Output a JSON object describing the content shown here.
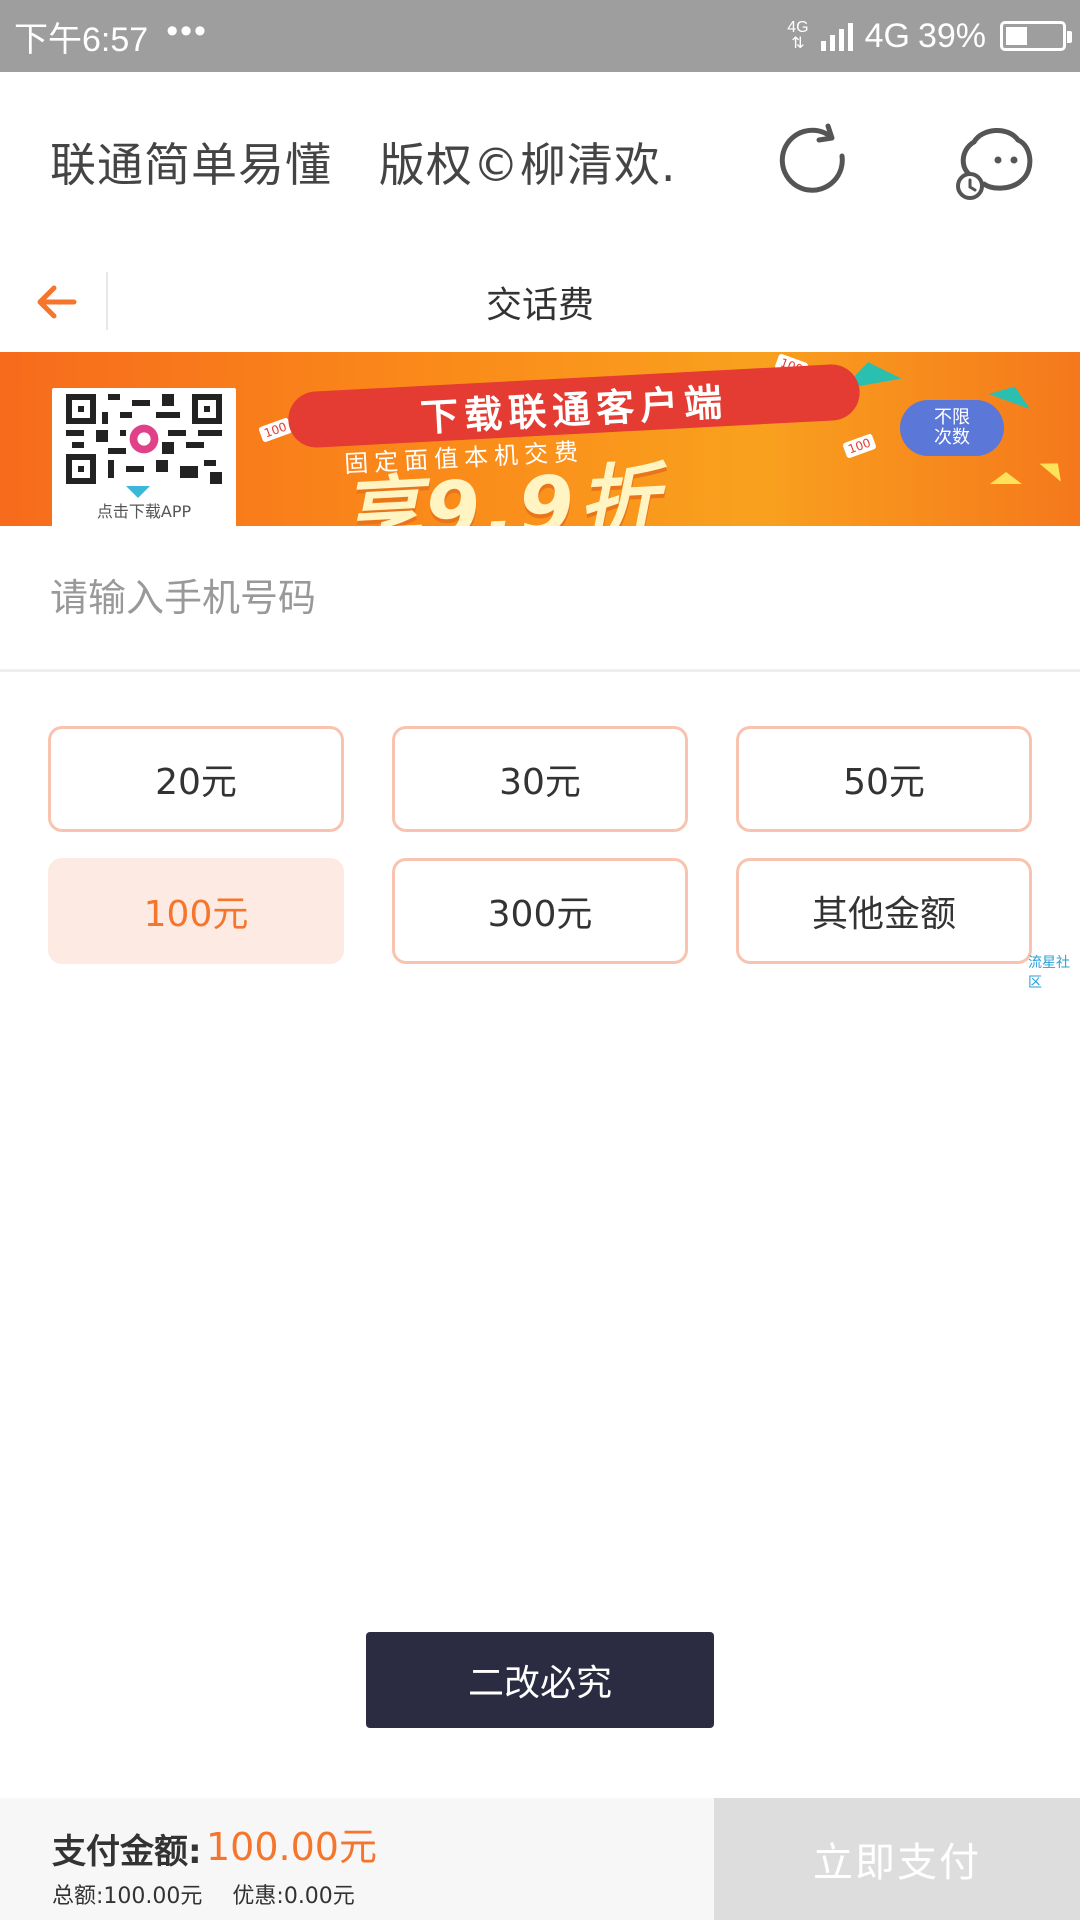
{
  "status_bar": {
    "time": "下午6:57",
    "dots": "•••",
    "network_small": "4G",
    "network": "4G",
    "battery_text": "39%",
    "battery_level": 0.39
  },
  "header": {
    "title": "联通简单易懂   版权©柳清欢."
  },
  "nav": {
    "title": "交话费"
  },
  "banner": {
    "qr_caption": "点击下载APP",
    "ribbon_text": "下载联通客户端",
    "subtitle": "固定面值本机交费",
    "headline": "享9.9折",
    "bubble_line1": "不限",
    "bubble_line2": "次数",
    "tag_100": "100"
  },
  "phone_input": {
    "placeholder": "请输入手机号码",
    "value": ""
  },
  "amounts": [
    {
      "label": "20元",
      "selected": false
    },
    {
      "label": "30元",
      "selected": false
    },
    {
      "label": "50元",
      "selected": false
    },
    {
      "label": "100元",
      "selected": true
    },
    {
      "label": "300元",
      "selected": false
    },
    {
      "label": "其他金额",
      "selected": false
    }
  ],
  "watermark": "流星社区",
  "dark_button": {
    "label": "二改必究"
  },
  "footer": {
    "pay_label": "支付金额:",
    "pay_amount": "100.00元",
    "total": "总额:100.00元",
    "discount": "优惠:0.00元",
    "pay_button": "立即支付"
  },
  "colors": {
    "accent": "#f6752c",
    "button_border": "#f8c4b0",
    "selected_bg": "#fdeae3",
    "dark_button": "#2b2c42",
    "status_bar": "#9e9e9e"
  }
}
